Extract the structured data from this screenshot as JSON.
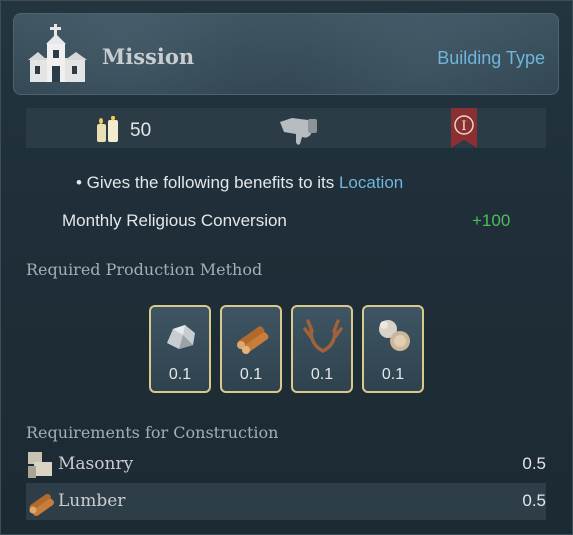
{
  "header": {
    "title": "Mission",
    "type_link": "Building Type",
    "icon": "church-icon"
  },
  "stats": {
    "cost": "50",
    "cost_icon": "candles-icon",
    "opinion_icon": "thumbs-down-icon",
    "rank_badge": "I"
  },
  "benefits": {
    "bullet": "• Gives the following benefits to its ",
    "location": "Location",
    "modifier_label": "Monthly Religious Conversion",
    "modifier_value": "+100",
    "modifier_color": "#4fbd5a"
  },
  "production": {
    "heading": "Required Production Method",
    "goods": [
      {
        "icon": "stone-icon",
        "value": "0.1"
      },
      {
        "icon": "lumber-icon",
        "value": "0.1"
      },
      {
        "icon": "antlers-icon",
        "value": "0.1"
      },
      {
        "icon": "wool-icon",
        "value": "0.1"
      }
    ]
  },
  "construction": {
    "heading": "Requirements for Construction",
    "items": [
      {
        "icon": "masonry-icon",
        "name": "Masonry",
        "amount": "0.5"
      },
      {
        "icon": "lumber-icon",
        "name": "Lumber",
        "amount": "0.5"
      }
    ]
  },
  "colors": {
    "accent": "#6fb5dc",
    "positive": "#4fbd5a",
    "border_gold": "#d9c98c"
  }
}
